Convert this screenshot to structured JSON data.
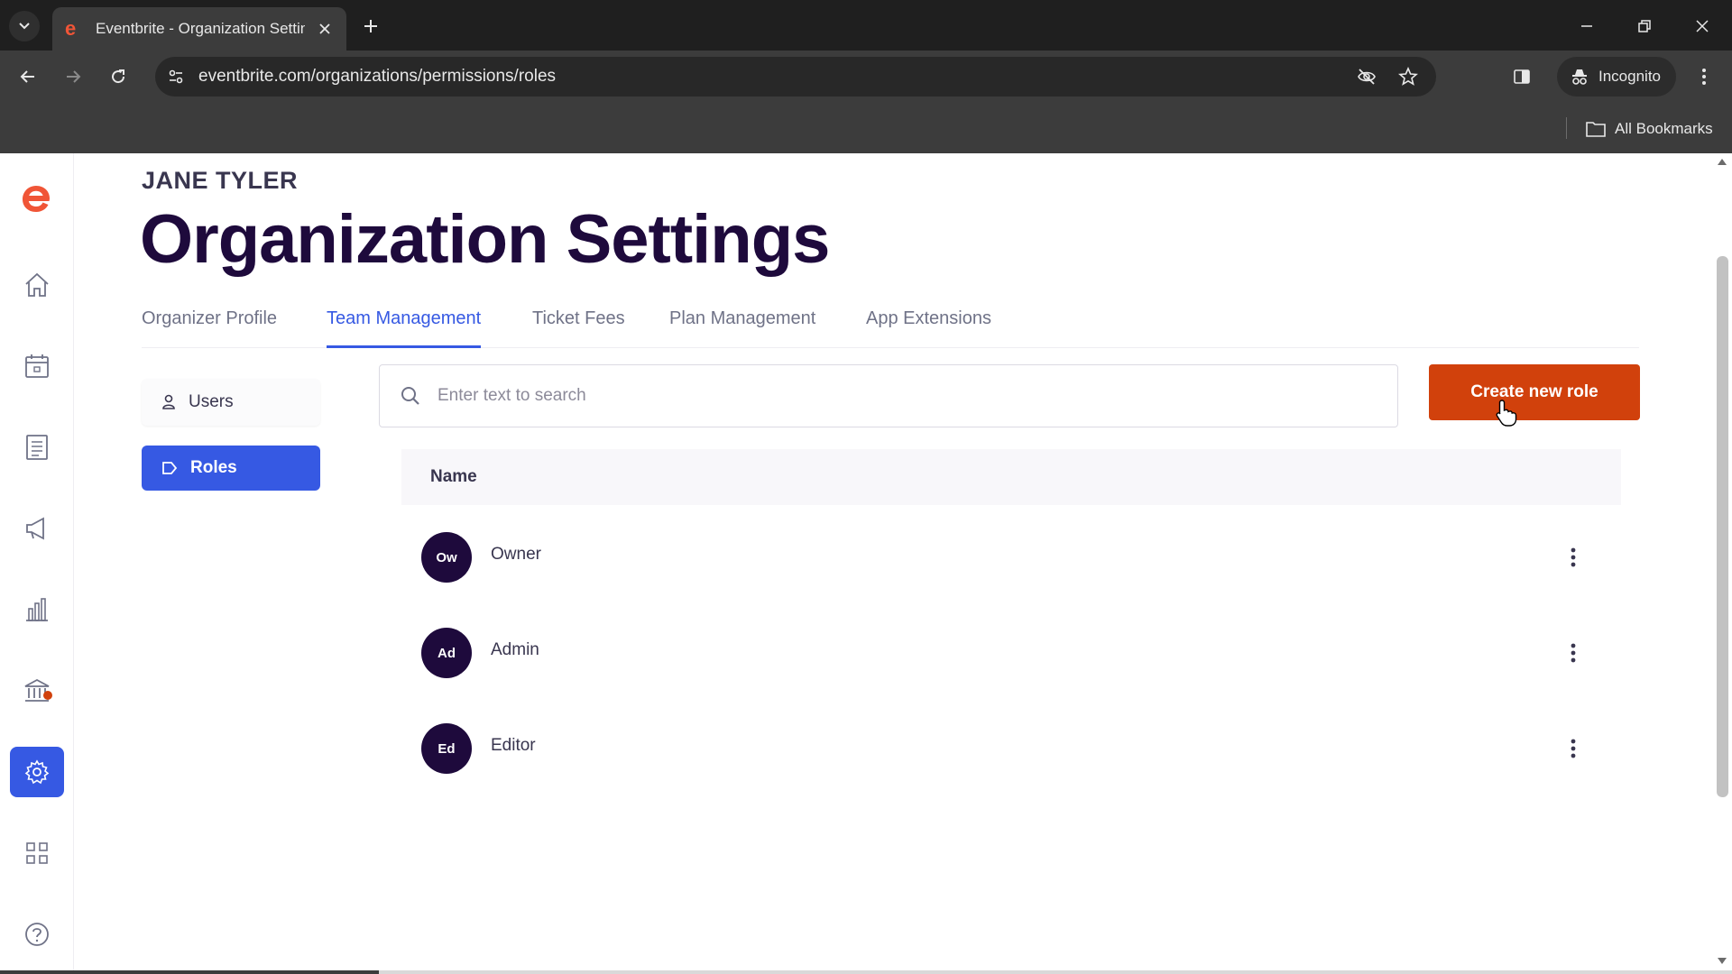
{
  "browser": {
    "tab_title": "Eventbrite - Organization Settings",
    "url": "eventbrite.com/organizations/permissions/roles",
    "incognito_label": "Incognito",
    "bookmarks_label": "All Bookmarks"
  },
  "colors": {
    "brand_orange": "#d1410c",
    "accent_blue": "#3659e3",
    "title_navy": "#1e0a3c"
  },
  "header": {
    "org_name": "JANE TYLER",
    "page_title": "Organization Settings"
  },
  "tabs": [
    {
      "label": "Organizer Profile",
      "active": false
    },
    {
      "label": "Team Management",
      "active": true
    },
    {
      "label": "Ticket Fees",
      "active": false
    },
    {
      "label": "Plan Management",
      "active": false
    },
    {
      "label": "App Extensions",
      "active": false
    }
  ],
  "sidenav": {
    "users_label": "Users",
    "roles_label": "Roles"
  },
  "search": {
    "placeholder": "Enter text to search",
    "value": ""
  },
  "actions": {
    "create_role_label": "Create new role"
  },
  "table": {
    "name_header": "Name",
    "roles": [
      {
        "initials": "Ow",
        "name": "Owner"
      },
      {
        "initials": "Ad",
        "name": "Admin"
      },
      {
        "initials": "Ed",
        "name": "Editor"
      }
    ]
  },
  "rail_icons": [
    "home-icon",
    "calendar-icon",
    "orders-icon",
    "megaphone-icon",
    "bar-chart-icon",
    "bank-icon",
    "gear-icon",
    "apps-grid-icon",
    "help-icon"
  ]
}
